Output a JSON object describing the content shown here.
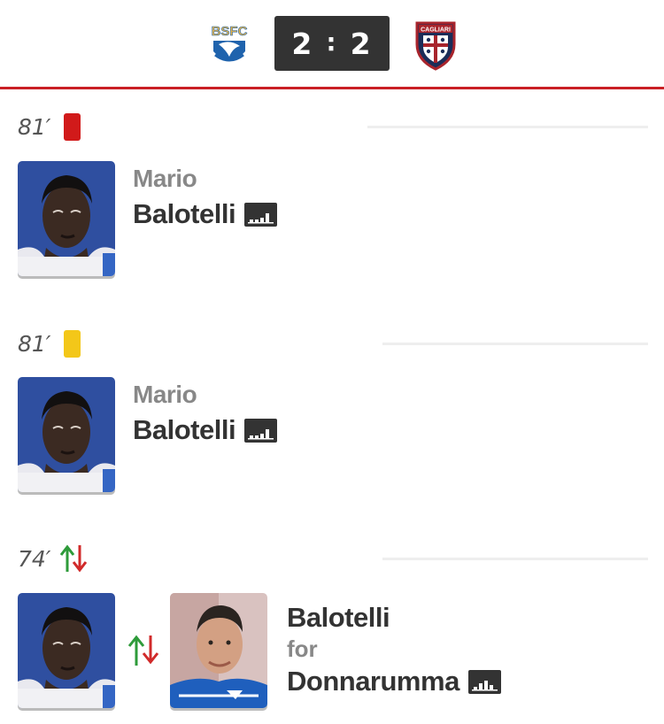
{
  "header": {
    "home_team_logo_text": "BSFC",
    "away_team_logo_text": "CAGLIARI",
    "home_score": "2",
    "separator": ":",
    "away_score": "2",
    "accent_color": "#c91f24"
  },
  "events": [
    {
      "minute": "81′",
      "type": "red-card",
      "player_first": "Mario",
      "player_last": "Balotelli",
      "icon": "stats-icon"
    },
    {
      "minute": "81′",
      "type": "yellow-card",
      "player_first": "Mario",
      "player_last": "Balotelli",
      "icon": "stats-icon"
    },
    {
      "minute": "74′",
      "type": "substitution",
      "player_in": "Balotelli",
      "for_label": "for",
      "player_out": "Donnarumma",
      "icon": "stats-icon"
    }
  ]
}
